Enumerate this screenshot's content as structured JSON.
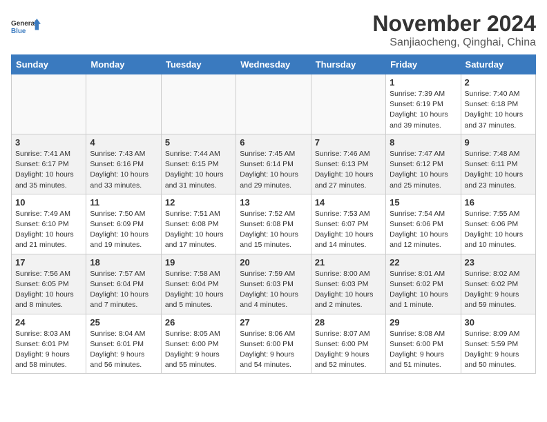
{
  "logo": {
    "line1": "General",
    "line2": "Blue"
  },
  "title": "November 2024",
  "location": "Sanjiaocheng, Qinghai, China",
  "days_of_week": [
    "Sunday",
    "Monday",
    "Tuesday",
    "Wednesday",
    "Thursday",
    "Friday",
    "Saturday"
  ],
  "weeks": [
    [
      {
        "day": "",
        "info": ""
      },
      {
        "day": "",
        "info": ""
      },
      {
        "day": "",
        "info": ""
      },
      {
        "day": "",
        "info": ""
      },
      {
        "day": "",
        "info": ""
      },
      {
        "day": "1",
        "info": "Sunrise: 7:39 AM\nSunset: 6:19 PM\nDaylight: 10 hours\nand 39 minutes."
      },
      {
        "day": "2",
        "info": "Sunrise: 7:40 AM\nSunset: 6:18 PM\nDaylight: 10 hours\nand 37 minutes."
      }
    ],
    [
      {
        "day": "3",
        "info": "Sunrise: 7:41 AM\nSunset: 6:17 PM\nDaylight: 10 hours\nand 35 minutes."
      },
      {
        "day": "4",
        "info": "Sunrise: 7:43 AM\nSunset: 6:16 PM\nDaylight: 10 hours\nand 33 minutes."
      },
      {
        "day": "5",
        "info": "Sunrise: 7:44 AM\nSunset: 6:15 PM\nDaylight: 10 hours\nand 31 minutes."
      },
      {
        "day": "6",
        "info": "Sunrise: 7:45 AM\nSunset: 6:14 PM\nDaylight: 10 hours\nand 29 minutes."
      },
      {
        "day": "7",
        "info": "Sunrise: 7:46 AM\nSunset: 6:13 PM\nDaylight: 10 hours\nand 27 minutes."
      },
      {
        "day": "8",
        "info": "Sunrise: 7:47 AM\nSunset: 6:12 PM\nDaylight: 10 hours\nand 25 minutes."
      },
      {
        "day": "9",
        "info": "Sunrise: 7:48 AM\nSunset: 6:11 PM\nDaylight: 10 hours\nand 23 minutes."
      }
    ],
    [
      {
        "day": "10",
        "info": "Sunrise: 7:49 AM\nSunset: 6:10 PM\nDaylight: 10 hours\nand 21 minutes."
      },
      {
        "day": "11",
        "info": "Sunrise: 7:50 AM\nSunset: 6:09 PM\nDaylight: 10 hours\nand 19 minutes."
      },
      {
        "day": "12",
        "info": "Sunrise: 7:51 AM\nSunset: 6:08 PM\nDaylight: 10 hours\nand 17 minutes."
      },
      {
        "day": "13",
        "info": "Sunrise: 7:52 AM\nSunset: 6:08 PM\nDaylight: 10 hours\nand 15 minutes."
      },
      {
        "day": "14",
        "info": "Sunrise: 7:53 AM\nSunset: 6:07 PM\nDaylight: 10 hours\nand 14 minutes."
      },
      {
        "day": "15",
        "info": "Sunrise: 7:54 AM\nSunset: 6:06 PM\nDaylight: 10 hours\nand 12 minutes."
      },
      {
        "day": "16",
        "info": "Sunrise: 7:55 AM\nSunset: 6:06 PM\nDaylight: 10 hours\nand 10 minutes."
      }
    ],
    [
      {
        "day": "17",
        "info": "Sunrise: 7:56 AM\nSunset: 6:05 PM\nDaylight: 10 hours\nand 8 minutes."
      },
      {
        "day": "18",
        "info": "Sunrise: 7:57 AM\nSunset: 6:04 PM\nDaylight: 10 hours\nand 7 minutes."
      },
      {
        "day": "19",
        "info": "Sunrise: 7:58 AM\nSunset: 6:04 PM\nDaylight: 10 hours\nand 5 minutes."
      },
      {
        "day": "20",
        "info": "Sunrise: 7:59 AM\nSunset: 6:03 PM\nDaylight: 10 hours\nand 4 minutes."
      },
      {
        "day": "21",
        "info": "Sunrise: 8:00 AM\nSunset: 6:03 PM\nDaylight: 10 hours\nand 2 minutes."
      },
      {
        "day": "22",
        "info": "Sunrise: 8:01 AM\nSunset: 6:02 PM\nDaylight: 10 hours\nand 1 minute."
      },
      {
        "day": "23",
        "info": "Sunrise: 8:02 AM\nSunset: 6:02 PM\nDaylight: 9 hours\nand 59 minutes."
      }
    ],
    [
      {
        "day": "24",
        "info": "Sunrise: 8:03 AM\nSunset: 6:01 PM\nDaylight: 9 hours\nand 58 minutes."
      },
      {
        "day": "25",
        "info": "Sunrise: 8:04 AM\nSunset: 6:01 PM\nDaylight: 9 hours\nand 56 minutes."
      },
      {
        "day": "26",
        "info": "Sunrise: 8:05 AM\nSunset: 6:00 PM\nDaylight: 9 hours\nand 55 minutes."
      },
      {
        "day": "27",
        "info": "Sunrise: 8:06 AM\nSunset: 6:00 PM\nDaylight: 9 hours\nand 54 minutes."
      },
      {
        "day": "28",
        "info": "Sunrise: 8:07 AM\nSunset: 6:00 PM\nDaylight: 9 hours\nand 52 minutes."
      },
      {
        "day": "29",
        "info": "Sunrise: 8:08 AM\nSunset: 6:00 PM\nDaylight: 9 hours\nand 51 minutes."
      },
      {
        "day": "30",
        "info": "Sunrise: 8:09 AM\nSunset: 5:59 PM\nDaylight: 9 hours\nand 50 minutes."
      }
    ]
  ]
}
